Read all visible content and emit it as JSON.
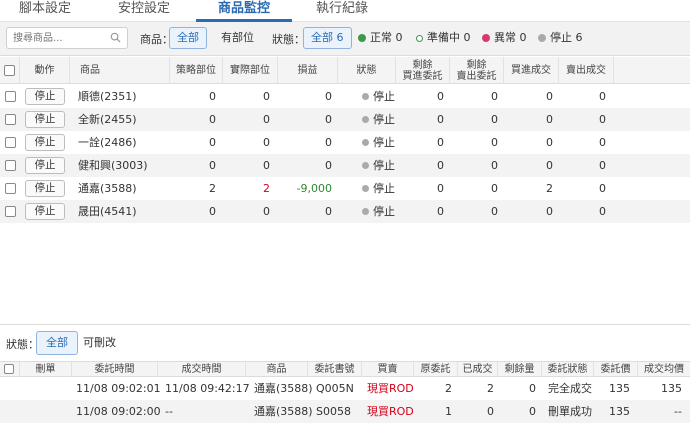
{
  "tabs": [
    {
      "label": "腳本設定",
      "active": false
    },
    {
      "label": "安控設定",
      "active": false
    },
    {
      "label": "商品監控",
      "active": true
    },
    {
      "label": "執行紀錄",
      "active": false
    }
  ],
  "filter": {
    "search_placeholder": "搜尋商品...",
    "product_label": "商品：",
    "product_all": "全部",
    "product_has_position": "有部位",
    "status_label": "狀態：",
    "status_all": "全部 6",
    "status_normal": "正常 0",
    "status_preparing": "準備中 0",
    "status_abnormal": "異常 0",
    "status_stopped": "停止 6",
    "colors": {
      "normal": "#3a9a4a",
      "preparing": "#3a9a4a",
      "abnormal": "#d63a6a",
      "stopped": "#aaaaaa"
    }
  },
  "main_table": {
    "headers": {
      "action": "動作",
      "product": "商品",
      "strategy_pos": "策略部位",
      "actual_pos": "實際部位",
      "pnl": "損益",
      "status": "狀態",
      "remain_buy": "剩餘\n買進委託",
      "remain_sell": "剩餘\n賣出委託",
      "buy_filled": "買進成交",
      "sell_filled": "賣出成交"
    },
    "rows": [
      {
        "button": "停止",
        "product": "順德(2351)",
        "strategy": "0",
        "actual": "0",
        "pnl": "0",
        "status": "停止",
        "remain_buy": "0",
        "remain_sell": "0",
        "buy_filled": "0",
        "sell_filled": "0"
      },
      {
        "button": "停止",
        "product": "全新(2455)",
        "strategy": "0",
        "actual": "0",
        "pnl": "0",
        "status": "停止",
        "remain_buy": "0",
        "remain_sell": "0",
        "buy_filled": "0",
        "sell_filled": "0"
      },
      {
        "button": "停止",
        "product": "一詮(2486)",
        "strategy": "0",
        "actual": "0",
        "pnl": "0",
        "status": "停止",
        "remain_buy": "0",
        "remain_sell": "0",
        "buy_filled": "0",
        "sell_filled": "0"
      },
      {
        "button": "停止",
        "product": "健和興(3003)",
        "strategy": "0",
        "actual": "0",
        "pnl": "0",
        "status": "停止",
        "remain_buy": "0",
        "remain_sell": "0",
        "buy_filled": "0",
        "sell_filled": "0"
      },
      {
        "button": "停止",
        "product": "通嘉(3588)",
        "strategy": "2",
        "actual": "2",
        "pnl": "-9,000",
        "status": "停止",
        "remain_buy": "0",
        "remain_sell": "0",
        "buy_filled": "2",
        "sell_filled": "0"
      },
      {
        "button": "停止",
        "product": "晟田(4541)",
        "strategy": "0",
        "actual": "0",
        "pnl": "0",
        "status": "停止",
        "remain_buy": "0",
        "remain_sell": "0",
        "buy_filled": "0",
        "sell_filled": "0"
      }
    ]
  },
  "order_filter": {
    "label": "狀態：",
    "all": "全部",
    "cancellable": "可刪改"
  },
  "order_table": {
    "headers": {
      "delete": "刪單",
      "order_time": "委託時間",
      "fill_time": "成交時間",
      "product": "商品",
      "order_no": "委託書號",
      "side": "買賣",
      "orig_qty": "原委託",
      "filled_qty": "已成交",
      "remain_qty": "剩餘量",
      "order_status": "委託狀態",
      "order_price": "委託價",
      "avg_price": "成交均價"
    },
    "rows": [
      {
        "order_time": "11/08 09:02:01",
        "fill_time": "11/08 09:42:17",
        "product": "通嘉(3588)",
        "order_no": "Q005N",
        "side": "現買ROD",
        "orig_qty": "2",
        "filled_qty": "2",
        "remain_qty": "0",
        "order_status": "完全成交",
        "order_price": "135",
        "avg_price": "135"
      },
      {
        "order_time": "11/08 09:02:00",
        "fill_time": "--",
        "product": "通嘉(3588)",
        "order_no": "S0058",
        "side": "現買ROD",
        "orig_qty": "1",
        "filled_qty": "0",
        "remain_qty": "0",
        "order_status": "刪單成功",
        "order_price": "135",
        "avg_price": "--"
      }
    ]
  }
}
